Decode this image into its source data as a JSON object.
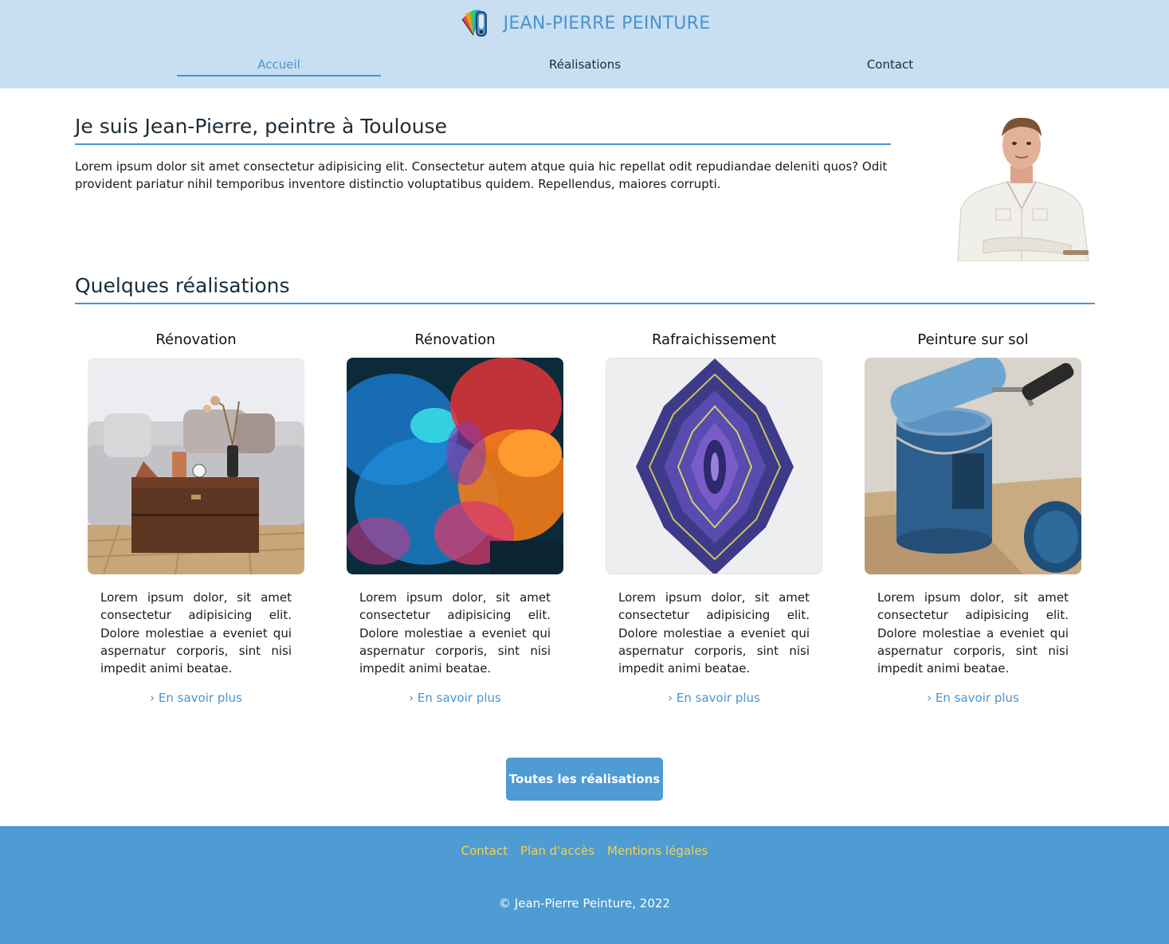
{
  "header": {
    "brand_name": "JEAN-PIERRE PEINTURE",
    "nav": [
      {
        "label": "Accueil",
        "active": true
      },
      {
        "label": "Réalisations",
        "active": false
      },
      {
        "label": "Contact",
        "active": false
      }
    ]
  },
  "intro": {
    "title": "Je suis Jean-Pierre, peintre à Toulouse",
    "text": "Lorem ipsum dolor sit amet consectetur adipisicing elit. Consectetur autem atque quia hic repellat odit repudiandae deleniti quos? Odit provident pariatur nihil temporibus inventore distinctio voluptatibus quidem. Repellendus, maiores corrupti."
  },
  "section": {
    "title": "Quelques réalisations",
    "cards": [
      {
        "title": "Rénovation",
        "text": "Lorem ipsum dolor, sit amet consectetur adipisicing elit. Dolore molestiae a eveniet qui aspernatur corporis, sint nisi impedit animi beatae.",
        "link": "› En savoir plus"
      },
      {
        "title": "Rénovation",
        "text": "Lorem ipsum dolor, sit amet consectetur adipisicing elit. Dolore molestiae a eveniet qui aspernatur corporis, sint nisi impedit animi beatae.",
        "link": "› En savoir plus"
      },
      {
        "title": "Rafraichissement",
        "text": "Lorem ipsum dolor, sit amet consectetur adipisicing elit. Dolore molestiae a eveniet qui aspernatur corporis, sint nisi impedit animi beatae.",
        "link": "› En savoir plus"
      },
      {
        "title": "Peinture sur sol",
        "text": "Lorem ipsum dolor, sit amet consectetur adipisicing elit. Dolore molestiae a eveniet qui aspernatur corporis, sint nisi impedit animi beatae.",
        "link": "› En savoir plus"
      }
    ],
    "cta": "Toutes les réalisations"
  },
  "footer": {
    "links": [
      "Contact",
      "Plan d'accès",
      "Mentions légales"
    ],
    "copyright": "© Jean-Pierre Peinture, 2022"
  },
  "colors": {
    "header_bg": "#c8def3",
    "accent": "#4a94cf",
    "footer_bg": "#4f9bd4",
    "footer_link": "#f3d44a"
  }
}
